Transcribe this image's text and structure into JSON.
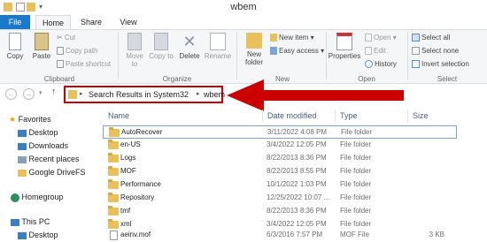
{
  "window": {
    "title": "wbem"
  },
  "tabs": {
    "file": "File",
    "home": "Home",
    "share": "Share",
    "view": "View"
  },
  "ribbon": {
    "clipboard": {
      "copy": "Copy",
      "paste": "Paste",
      "cut": "Cut",
      "copy_path": "Copy path",
      "paste_shortcut": "Paste shortcut",
      "label": "Clipboard"
    },
    "organize": {
      "move_to": "Move to",
      "copy_to": "Copy to",
      "delete": "Delete",
      "rename": "Rename",
      "label": "Organize"
    },
    "new": {
      "new_folder": "New folder",
      "new_item": "New item ▾",
      "easy_access": "Easy access ▾",
      "label": "New"
    },
    "open": {
      "properties": "Properties",
      "open": "Open ▾",
      "edit": "Edit",
      "history": "History",
      "label": "Open"
    },
    "select": {
      "select_all": "Select all",
      "select_none": "Select none",
      "invert_selection": "Invert selection",
      "label": "Select"
    }
  },
  "address": {
    "crumbs": [
      "Search Results in System32",
      "wbem"
    ]
  },
  "nav": {
    "favorites": "Favorites",
    "favorite_items": [
      "Desktop",
      "Downloads",
      "Recent places",
      "Google DriveFS"
    ],
    "homegroup": "Homegroup",
    "this_pc": "This PC",
    "pc_items": [
      "Desktop"
    ]
  },
  "columns": {
    "name": "Name",
    "date": "Date modified",
    "type": "Type",
    "size": "Size"
  },
  "files": [
    {
      "name": "AutoRecover",
      "date": "3/11/2022 4:08 PM",
      "type": "File folder",
      "size": "",
      "kind": "folder"
    },
    {
      "name": "en-US",
      "date": "3/4/2022 12:05 PM",
      "type": "File folder",
      "size": "",
      "kind": "folder"
    },
    {
      "name": "Logs",
      "date": "8/22/2013 8:36 PM",
      "type": "File folder",
      "size": "",
      "kind": "folder"
    },
    {
      "name": "MOF",
      "date": "8/22/2013 8:55 PM",
      "type": "File folder",
      "size": "",
      "kind": "folder"
    },
    {
      "name": "Performance",
      "date": "10/1/2022 1:03 PM",
      "type": "File folder",
      "size": "",
      "kind": "folder"
    },
    {
      "name": "Repository",
      "date": "12/25/2022 10:07 ...",
      "type": "File folder",
      "size": "",
      "kind": "folder"
    },
    {
      "name": "tmf",
      "date": "8/22/2013 8:36 PM",
      "type": "File folder",
      "size": "",
      "kind": "folder"
    },
    {
      "name": "xml",
      "date": "3/4/2022 12:05 PM",
      "type": "File folder",
      "size": "",
      "kind": "folder"
    },
    {
      "name": "aeinv.mof",
      "date": "6/3/2016 7:57 PM",
      "type": "MOF File",
      "size": "3 KB",
      "kind": "file"
    }
  ],
  "colors": {
    "accent": "#1979ca",
    "highlight": "#cc0000",
    "folder": "#e8c15a"
  }
}
